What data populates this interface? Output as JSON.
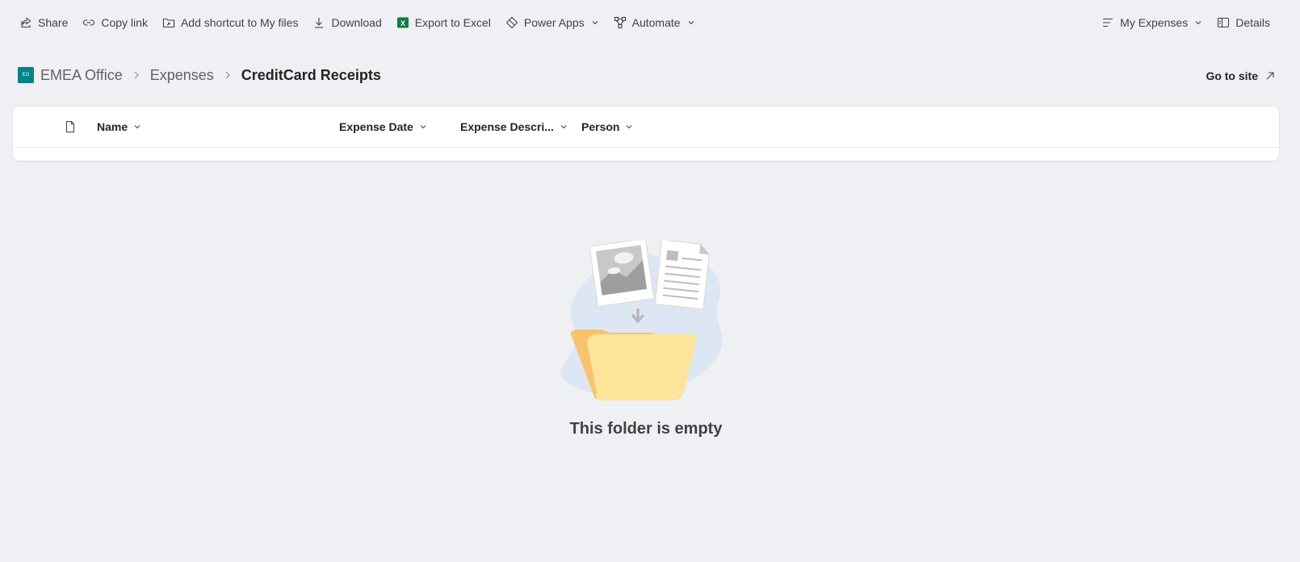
{
  "toolbar": {
    "share_label": "Share",
    "copy_link_label": "Copy link",
    "add_shortcut_label": "Add shortcut to My files",
    "download_label": "Download",
    "export_excel_label": "Export to Excel",
    "power_apps_label": "Power Apps",
    "automate_label": "Automate",
    "view_label": "My Expenses",
    "details_label": "Details"
  },
  "breadcrumb": {
    "logo_text": "EO",
    "site": "EMEA Office",
    "library": "Expenses",
    "current": "CreditCard Receipts"
  },
  "go_to_site_label": "Go to site",
  "columns": {
    "name": "Name",
    "expense_date": "Expense Date",
    "expense_description": "Expense Descri...",
    "person": "Person"
  },
  "empty_state": {
    "message": "This folder is empty"
  },
  "colors": {
    "site_logo": "#038387",
    "excel_green": "#107c41",
    "background": "#eef0f4"
  }
}
